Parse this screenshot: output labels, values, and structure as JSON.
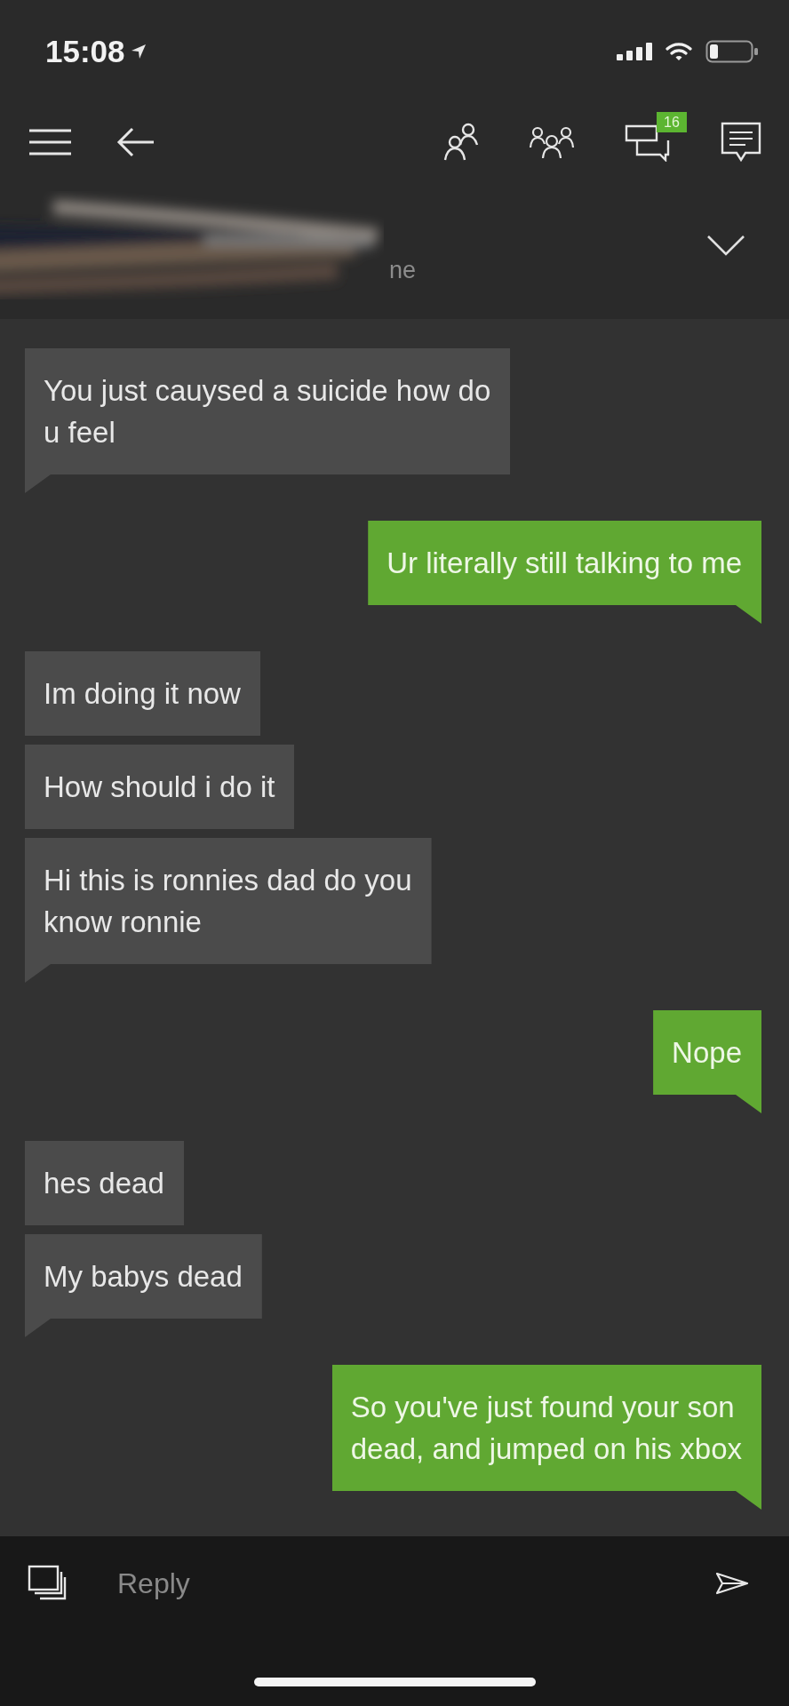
{
  "status_bar": {
    "time": "15:08"
  },
  "toolbar": {
    "chats_badge": "16"
  },
  "conversation": {
    "subtitle": "ne"
  },
  "message_groups": [
    {
      "kind": "received",
      "bubbles": [
        "You just cauysed a suicide how do\nu feel"
      ]
    },
    {
      "kind": "sent",
      "bubbles": [
        "Ur literally still talking to me"
      ]
    },
    {
      "kind": "received",
      "bubbles": [
        "Im doing it now",
        "How should i do it",
        "Hi this is ronnies dad do you\nknow ronnie"
      ]
    },
    {
      "kind": "sent",
      "bubbles": [
        "Nope"
      ]
    },
    {
      "kind": "received",
      "bubbles": [
        "hes dead",
        "My babys dead"
      ]
    },
    {
      "kind": "sent",
      "bubbles": [
        "So you've just found your son\ndead, and jumped on his xbox"
      ]
    }
  ],
  "composer": {
    "placeholder": "Reply"
  }
}
